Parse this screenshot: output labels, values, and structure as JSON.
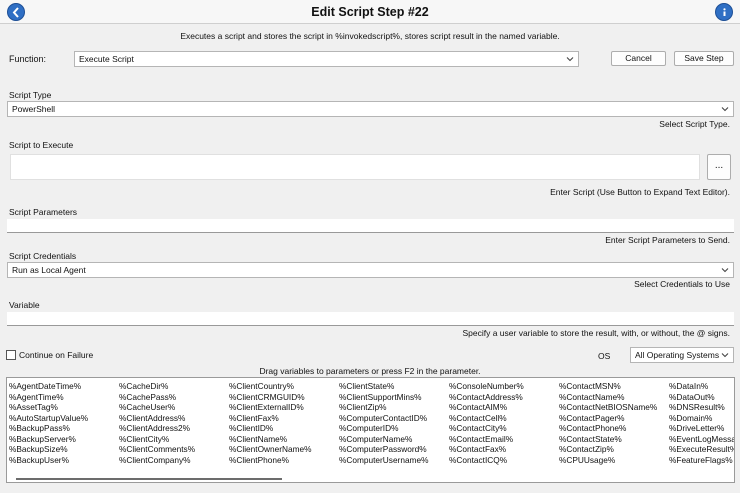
{
  "window": {
    "title": "Edit Script Step #22"
  },
  "description": "Executes a script and stores the script in %invokedscript%, stores script result in the named variable.",
  "function": {
    "label": "Function:",
    "value": "Execute Script"
  },
  "buttons": {
    "cancel": "Cancel",
    "save": "Save Step",
    "expand": "..."
  },
  "script_type": {
    "label": "Script Type",
    "value": "PowerShell",
    "hint": "Select Script Type."
  },
  "script_to_execute": {
    "label": "Script to Execute",
    "value": "",
    "hint": "Enter Script (Use Button to Expand Text Editor)."
  },
  "script_parameters": {
    "label": "Script Parameters",
    "value": "",
    "hint": "Enter Script Parameters to Send."
  },
  "script_credentials": {
    "label": "Script Credentials",
    "value": "Run as Local Agent",
    "hint": "Select Credentials to Use"
  },
  "variable": {
    "label": "Variable",
    "value": "",
    "hint": "Specify a user variable to store the result, with, or without, the @ signs."
  },
  "continue_on_failure": {
    "label": "Continue on Failure",
    "checked": false
  },
  "os": {
    "label": "OS",
    "value": "All Operating Systems"
  },
  "drag_hint": "Drag variables to parameters or press F2 in the parameter.",
  "variables": [
    [
      "%AgentDateTime%",
      "%AgentTime%",
      "%AssetTag%",
      "%AutoStartupValue%",
      "%BackupPass%",
      "%BackupServer%",
      "%BackupSize%",
      "%BackupUser%"
    ],
    [
      "%CacheDir%",
      "%CachePass%",
      "%CacheUser%",
      "%ClientAddress%",
      "%ClientAddress2%",
      "%ClientCity%",
      "%ClientComments%",
      "%ClientCompany%"
    ],
    [
      "%ClientCountry%",
      "%ClientCRMGUID%",
      "%ClientExternalID%",
      "%ClientFax%",
      "%ClientID%",
      "%ClientName%",
      "%ClientOwnerName%",
      "%ClientPhone%"
    ],
    [
      "%ClientState%",
      "%ClientSupportMins%",
      "%ClientZip%",
      "%ComputerContactID%",
      "%ComputerID%",
      "%ComputerName%",
      "%ComputerPassword%",
      "%ComputerUsername%"
    ],
    [
      "%ConsoleNumber%",
      "%ContactAddress%",
      "%ContactAIM%",
      "%ContactCell%",
      "%ContactCity%",
      "%ContactEmail%",
      "%ContactFax%",
      "%ContactICQ%"
    ],
    [
      "%ContactMSN%",
      "%ContactName%",
      "%ContactNetBIOSName%",
      "%ContactPager%",
      "%ContactPhone%",
      "%ContactState%",
      "%ContactZip%",
      "%CPUUsage%"
    ],
    [
      "%DataIn%",
      "%DataOut%",
      "%DNSResult%",
      "%Domain%",
      "%DriveLetter%",
      "%EventLogMessa",
      "%ExecuteResult%",
      "%FeatureFlags%"
    ]
  ]
}
